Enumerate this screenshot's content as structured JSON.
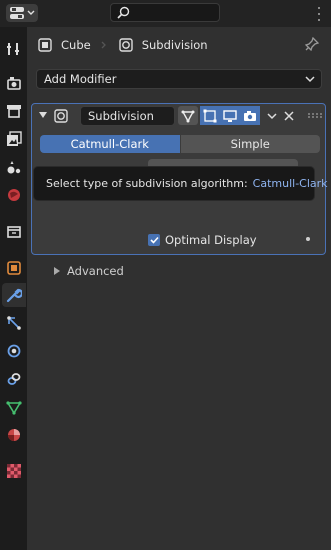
{
  "header": {
    "editor_type_icon": "properties-editor-icon",
    "search": {
      "placeholder": "",
      "icon": "search-icon"
    }
  },
  "sidebar": {
    "tabs": [
      {
        "name": "tool",
        "icon": "tool-icon"
      },
      {
        "name": "render",
        "icon": "render-icon"
      },
      {
        "name": "output",
        "icon": "output-icon"
      },
      {
        "name": "view-layer",
        "icon": "view-layer-icon"
      },
      {
        "name": "scene",
        "icon": "scene-icon"
      },
      {
        "name": "world",
        "icon": "world-icon"
      },
      {
        "name": "collection",
        "icon": "collection-icon"
      },
      {
        "name": "object",
        "icon": "object-icon"
      },
      {
        "name": "modifiers",
        "icon": "wrench-icon",
        "active": true
      },
      {
        "name": "particles",
        "icon": "particles-icon"
      },
      {
        "name": "physics",
        "icon": "physics-icon"
      },
      {
        "name": "constraints",
        "icon": "constraint-icon"
      },
      {
        "name": "data",
        "icon": "mesh-data-icon"
      },
      {
        "name": "material",
        "icon": "material-icon"
      },
      {
        "name": "texture",
        "icon": "texture-icon"
      }
    ]
  },
  "breadcrumb": {
    "object": "Cube",
    "modifier": "Subdivision"
  },
  "add_modifier": {
    "label": "Add Modifier"
  },
  "modifier": {
    "name": "Subdivision",
    "algorithm_options": [
      "Catmull-Clark",
      "Simple"
    ],
    "selected_algorithm": "Catmull-Clark",
    "optimal_display_label": "Optimal Display",
    "optimal_display": true,
    "advanced_label": "Advanced"
  },
  "tooltip": {
    "text": "Select type of subdivision algorithm:",
    "value": "Catmull-Clark"
  },
  "colors": {
    "accent": "#4772b3",
    "panel_border": "#4a72b7",
    "background": "#303030",
    "sidebar": "#1c1c1c"
  }
}
